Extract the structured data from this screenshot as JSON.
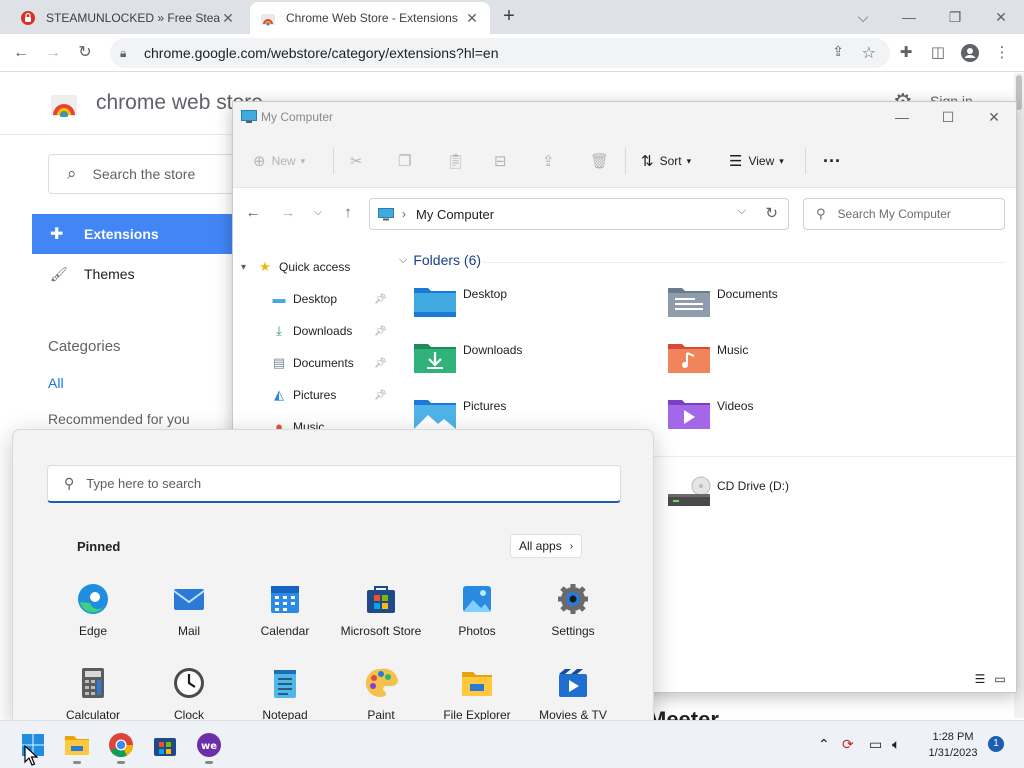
{
  "browser": {
    "tabs": [
      {
        "title": "STEAMUNLOCKED » Free Steam",
        "active": false
      },
      {
        "title": "Chrome Web Store - Extensions",
        "active": true
      }
    ],
    "new_tab_symbol": "+",
    "caption_icons": [
      "chevron-down-icon",
      "minimize-icon",
      "restore-icon",
      "close-icon"
    ],
    "url": "chrome.google.com/webstore/category/extensions?hl=en",
    "toolbar_icons": [
      "back-icon",
      "forward-icon",
      "reload-icon",
      "share-icon",
      "star-icon",
      "extensions-icon",
      "sidepanel-icon",
      "profile-icon",
      "menu-icon"
    ]
  },
  "store": {
    "name": "chrome web store",
    "signin": "Sign in",
    "search_placeholder": "Search the store",
    "nav": [
      {
        "label": "Extensions",
        "selected": true
      },
      {
        "label": "Themes",
        "selected": false
      }
    ],
    "categories_heading": "Categories",
    "categories": [
      "All",
      "Recommended for you"
    ],
    "bottom_title": "Meeter",
    "colors": {
      "accent": "#4285f4",
      "link": "#1a73e8"
    }
  },
  "explorer": {
    "title": "My Computer",
    "commands": [
      {
        "label": "New",
        "icon": "new-icon",
        "enabled": false,
        "dropdown": true
      },
      {
        "label": "",
        "icon": "cut-icon",
        "enabled": false
      },
      {
        "label": "",
        "icon": "copy-icon",
        "enabled": false
      },
      {
        "label": "",
        "icon": "paste-icon",
        "enabled": false
      },
      {
        "label": "",
        "icon": "rename-icon",
        "enabled": false
      },
      {
        "label": "",
        "icon": "share-icon",
        "enabled": false
      },
      {
        "label": "",
        "icon": "delete-icon",
        "enabled": false
      },
      {
        "label": "Sort",
        "icon": "sort-icon",
        "enabled": true,
        "dropdown": true
      },
      {
        "label": "View",
        "icon": "view-icon",
        "enabled": true,
        "dropdown": true
      },
      {
        "label": "···",
        "icon": "more-icon",
        "enabled": true
      }
    ],
    "address": {
      "path": "My Computer",
      "search_placeholder": "Search My Computer"
    },
    "nav_pane": {
      "quick_access": "Quick access",
      "items": [
        {
          "label": "Desktop",
          "icon": "desktop-icon",
          "pinned": true
        },
        {
          "label": "Downloads",
          "icon": "downloads-icon",
          "pinned": true
        },
        {
          "label": "Documents",
          "icon": "documents-icon",
          "pinned": true
        },
        {
          "label": "Pictures",
          "icon": "pictures-icon",
          "pinned": true
        },
        {
          "label": "Music",
          "icon": "music-icon",
          "pinned": false
        }
      ]
    },
    "folders_heading": "Folders (6)",
    "folders": [
      {
        "name": "Desktop",
        "icon": "desktop-folder-icon"
      },
      {
        "name": "Documents",
        "icon": "documents-folder-icon"
      },
      {
        "name": "Downloads",
        "icon": "downloads-folder-icon"
      },
      {
        "name": "Music",
        "icon": "music-folder-icon"
      },
      {
        "name": "Pictures",
        "icon": "pictures-folder-icon"
      },
      {
        "name": "Videos",
        "icon": "videos-folder-icon"
      }
    ],
    "drives": [
      {
        "name": "CD Drive (D:)",
        "icon": "cd-drive-icon"
      }
    ]
  },
  "start_menu": {
    "search_placeholder": "Type here to search",
    "pinned_label": "Pinned",
    "all_apps_label": "All apps",
    "apps": [
      {
        "label": "Edge",
        "icon": "edge-icon"
      },
      {
        "label": "Mail",
        "icon": "mail-icon"
      },
      {
        "label": "Calendar",
        "icon": "calendar-icon"
      },
      {
        "label": "Microsoft Store",
        "icon": "store-icon"
      },
      {
        "label": "Photos",
        "icon": "photos-icon"
      },
      {
        "label": "Settings",
        "icon": "settings-icon"
      },
      {
        "label": "Calculator",
        "icon": "calculator-icon"
      },
      {
        "label": "Clock",
        "icon": "clock-icon"
      },
      {
        "label": "Notepad",
        "icon": "notepad-icon"
      },
      {
        "label": "Paint",
        "icon": "paint-icon"
      },
      {
        "label": "File Explorer",
        "icon": "file-explorer-icon"
      },
      {
        "label": "Movies & TV",
        "icon": "movies-tv-icon"
      }
    ]
  },
  "taskbar": {
    "apps": [
      "start-icon",
      "file-explorer-icon",
      "chrome-icon",
      "store-icon",
      "app-icon"
    ],
    "tray_icons": [
      "chevron-up-icon",
      "sync-icon",
      "network-icon",
      "volume-icon"
    ],
    "time": "1:28 PM",
    "date": "1/31/2023",
    "notification_count": "1"
  }
}
